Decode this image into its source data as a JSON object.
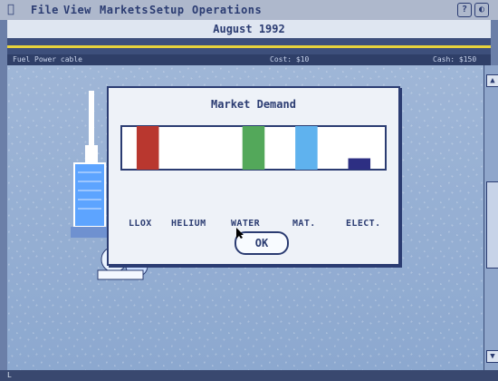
{
  "menubar": {
    "items": [
      "File",
      "View",
      "Markets",
      "Setup",
      "Operations"
    ],
    "icons": [
      "apple-icon",
      "help-icon",
      "power-icon"
    ]
  },
  "window": {
    "title": "August 1992"
  },
  "status": {
    "left": "Fuel",
    "middle": "Power cable",
    "cost_label": "Cost: $10",
    "right_label": "Cash: $150"
  },
  "dialog": {
    "title": "Market Demand",
    "ok_label": "OK"
  },
  "chart_data": {
    "type": "bar",
    "title": "Market Demand",
    "categories": [
      "LLOX",
      "HELIUM",
      "WATER",
      "MAT.",
      "ELECT."
    ],
    "values": [
      100,
      0,
      100,
      100,
      26
    ],
    "colors": [
      "#b9372f",
      "#ffffff",
      "#53a85a",
      "#5fb2ee",
      "#2d2f83"
    ],
    "ylim": [
      0,
      100
    ]
  },
  "bottombar": {
    "left": "L",
    "middle": "",
    "right": ""
  }
}
